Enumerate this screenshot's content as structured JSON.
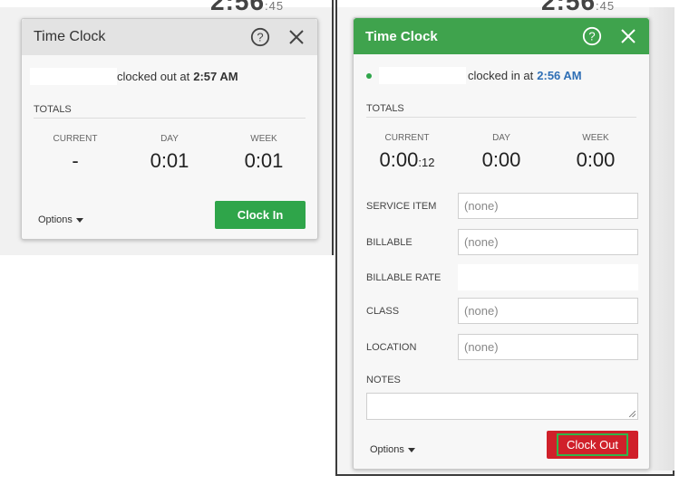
{
  "left": {
    "bg_time": "2:56",
    "bg_time_sec": ":45",
    "title": "Time Clock",
    "status_text": "clocked out at",
    "status_time": "2:57 AM",
    "totals_label": "TOTALS",
    "totals": [
      {
        "label": "CURRENT",
        "value": "-",
        "suffix": ""
      },
      {
        "label": "DAY",
        "value": "0:01",
        "suffix": ""
      },
      {
        "label": "WEEK",
        "value": "0:01",
        "suffix": ""
      }
    ],
    "options_label": "Options",
    "clock_in_label": "Clock In"
  },
  "right": {
    "bg_time": "2:56",
    "bg_time_sec": ":45",
    "title": "Time Clock",
    "status_text": "clocked in at",
    "status_time": "2:56 AM",
    "totals_label": "TOTALS",
    "totals": [
      {
        "label": "CURRENT",
        "value": "0:00",
        "suffix": ":12"
      },
      {
        "label": "DAY",
        "value": "0:00",
        "suffix": ""
      },
      {
        "label": "WEEK",
        "value": "0:00",
        "suffix": ""
      }
    ],
    "fields": [
      {
        "label": "SERVICE ITEM",
        "value": "(none)"
      },
      {
        "label": "BILLABLE",
        "value": "(none)"
      },
      {
        "label": "BILLABLE RATE",
        "value": ""
      },
      {
        "label": "CLASS",
        "value": "(none)"
      },
      {
        "label": "LOCATION",
        "value": "(none)"
      }
    ],
    "notes_label": "NOTES",
    "notes_value": "",
    "options_label": "Options",
    "clock_out_label": "Clock Out"
  },
  "colors": {
    "header_green": "#3fa34d",
    "button_green": "#2fa54a",
    "button_red": "#d0202a",
    "time_blue": "#2f6fb5",
    "status_dot": "#2fa54a"
  },
  "icons": [
    "help-icon",
    "close-icon",
    "caret-down-icon",
    "status-dot-icon"
  ]
}
